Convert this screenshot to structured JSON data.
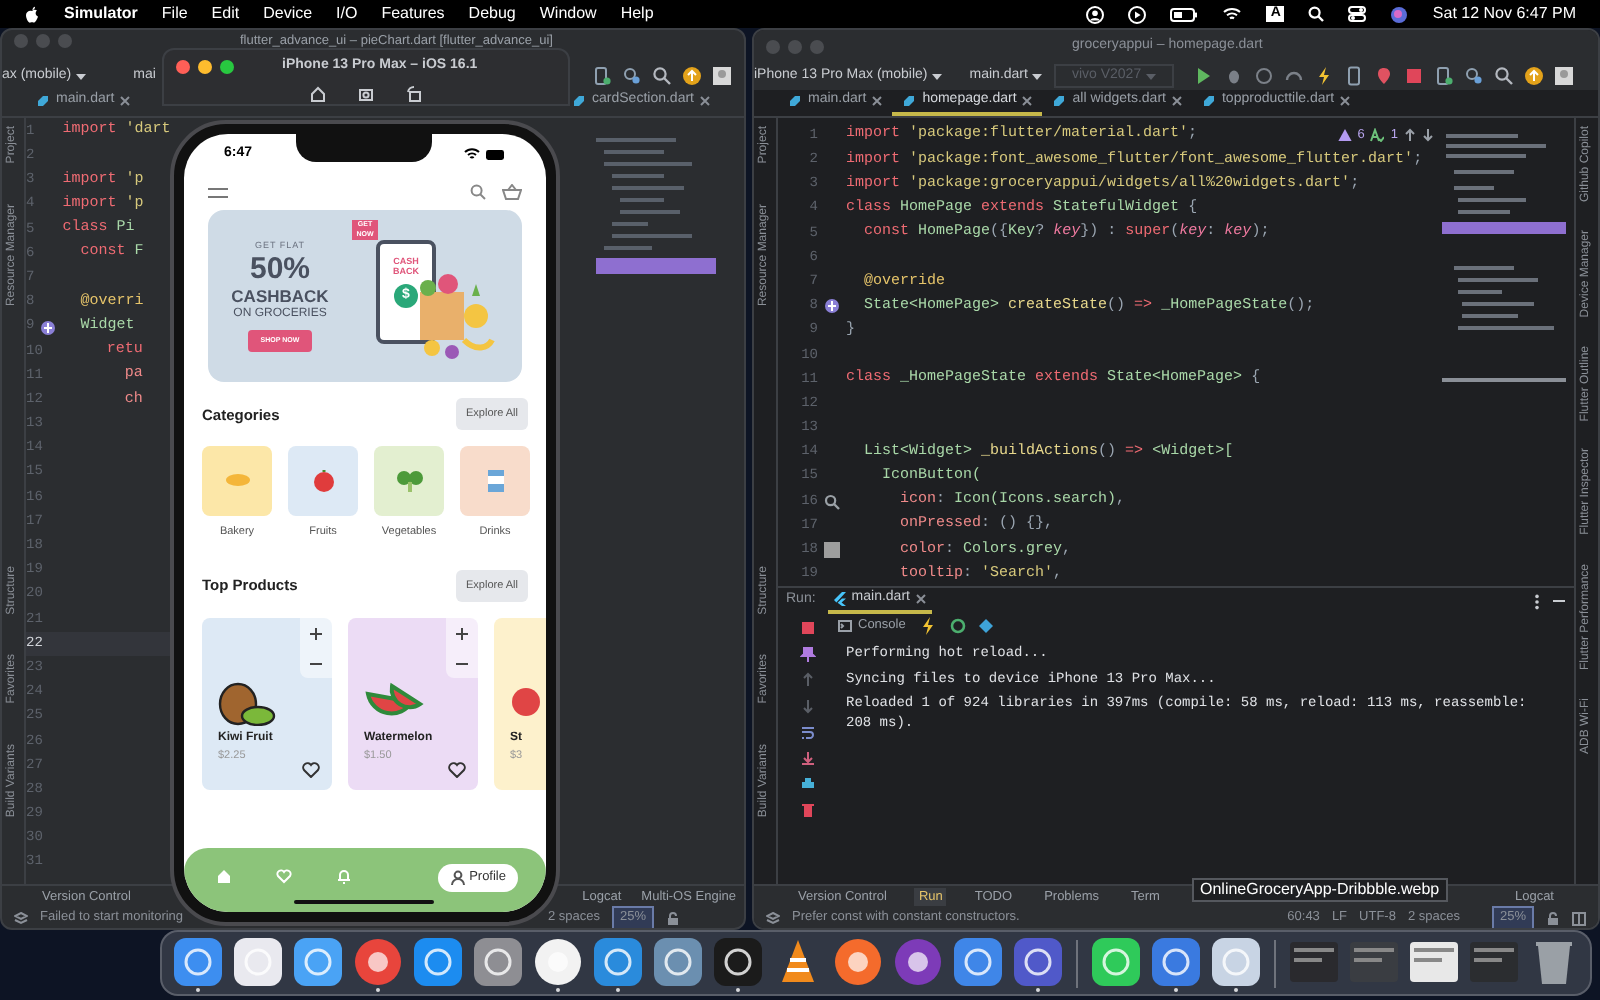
{
  "menu_bar": {
    "app": "Simulator",
    "items": [
      "File",
      "Edit",
      "Device",
      "I/O",
      "Features",
      "Debug",
      "Window",
      "Help"
    ],
    "input_source": "A",
    "clock": "Sat 12 Nov 6:47 PM"
  },
  "left_ide": {
    "title": "flutter_advance_ui – pieChart.dart [flutter_advance_ui]",
    "device": "ax (mobile)",
    "run_config": "mai",
    "tabs": [
      {
        "label": "main.dart",
        "selected": false
      },
      {
        "label": "cardSection.dart",
        "selected": false
      }
    ],
    "side_labels": [
      "Project",
      "Resource Manager",
      "Structure",
      "Favorites",
      "Build Variants"
    ],
    "lines": [
      {
        "number": "1",
        "tokens": [
          {
            "text": "import ",
            "kind": "kw"
          },
          {
            "text": "'dart",
            "kind": "str"
          }
        ]
      },
      {
        "number": "2"
      },
      {
        "number": "3",
        "tokens": [
          {
            "text": "import ",
            "kind": "kw"
          },
          {
            "text": "'p",
            "kind": "str"
          }
        ]
      },
      {
        "number": "4",
        "tokens": [
          {
            "text": "import ",
            "kind": "kw"
          },
          {
            "text": "'p",
            "kind": "str"
          }
        ]
      },
      {
        "number": "5",
        "tokens": [
          {
            "text": "class ",
            "kind": "kw"
          },
          {
            "text": "Pi",
            "kind": "type"
          }
        ]
      },
      {
        "number": "6",
        "tokens": [
          {
            "text": "  const ",
            "kind": "kw"
          },
          {
            "text": "F",
            "kind": "type"
          }
        ]
      },
      {
        "number": "7"
      },
      {
        "number": "8",
        "tokens": [
          {
            "text": "  @overri",
            "kind": "ann"
          }
        ]
      },
      {
        "number": "9",
        "tokens": [
          {
            "text": "  Widget",
            "kind": "type"
          }
        ],
        "marker": {
          "kind": "override"
        }
      },
      {
        "number": "10",
        "tokens": [
          {
            "text": "    retu",
            "kind": "kw"
          }
        ]
      },
      {
        "number": "11",
        "tokens": [
          {
            "text": "      pa",
            "kind": "prop"
          }
        ]
      },
      {
        "number": "12",
        "tokens": [
          {
            "text": "      ch",
            "kind": "prop"
          }
        ]
      },
      {
        "number": "13"
      },
      {
        "number": "14"
      },
      {
        "number": "15"
      },
      {
        "number": "16"
      },
      {
        "number": "17"
      },
      {
        "number": "18"
      },
      {
        "number": "19"
      },
      {
        "number": "20"
      },
      {
        "number": "21"
      },
      {
        "number": "22",
        "current": true
      },
      {
        "number": "23"
      },
      {
        "number": "24"
      },
      {
        "number": "25"
      },
      {
        "number": "26"
      },
      {
        "number": "27"
      },
      {
        "number": "28"
      },
      {
        "number": "29"
      },
      {
        "number": "30"
      },
      {
        "number": "31"
      }
    ],
    "bottom_tabs": [
      {
        "label": "Version Control",
        "selected": false
      },
      {
        "label": "Logcat",
        "selected": false
      },
      {
        "label": "Multi-OS Engine",
        "selected": false
      }
    ],
    "status": {
      "message": "Failed to start monitoring",
      "indent": "2 spaces",
      "memory": "25%"
    }
  },
  "simulator": {
    "title": "iPhone 13 Pro Max – iOS 16.1"
  },
  "phone": {
    "time": "6:47",
    "banner": {
      "pre": "GET FLAT",
      "amount": "50%",
      "headline": "CASHBACK",
      "sub": "ON GROCERIES",
      "button": "SHOP NOW",
      "tag": "GET NOW",
      "screen_text": "CASH BACK",
      "coin": "$"
    },
    "categories": {
      "title": "Categories",
      "action": "Explore All",
      "items": [
        {
          "label": "Bakery",
          "color": "#fce7a8"
        },
        {
          "label": "Fruits",
          "color": "#dde9f5"
        },
        {
          "label": "Vegetables",
          "color": "#e3efd0"
        },
        {
          "label": "Drinks",
          "color": "#f8dccb"
        }
      ]
    },
    "products": {
      "title": "Top Products",
      "action": "Explore All",
      "items": [
        {
          "name": "Kiwi Fruit",
          "price": "$2.25",
          "color": "#dde9f5"
        },
        {
          "name": "Watermelon",
          "price": "$1.50",
          "color": "#ecdcf5"
        },
        {
          "name": "St",
          "price": "$3",
          "color": "#fdf1cc"
        }
      ]
    },
    "nav": [
      {
        "kind": "home",
        "selected": false
      },
      {
        "kind": "heart",
        "selected": false
      },
      {
        "kind": "bell",
        "selected": false
      },
      {
        "kind": "profile",
        "label": "Profile",
        "selected": true
      }
    ]
  },
  "right_ide": {
    "title": "groceryappui – homepage.dart",
    "device": "iPhone 13 Pro Max (mobile)",
    "run_config": "main.dart",
    "other_device": {
      "label": "vivo V2027",
      "disabled": true
    },
    "tabs": [
      {
        "label": "main.dart",
        "selected": false
      },
      {
        "label": "homepage.dart",
        "selected": true
      },
      {
        "label": "all widgets.dart",
        "selected": false
      },
      {
        "label": "topproducttile.dart",
        "selected": false
      }
    ],
    "inspection": {
      "warnings": "6",
      "typos": "1"
    },
    "side_labels": [
      "Project",
      "Resource Manager",
      "Structure",
      "Favorites",
      "Build Variants"
    ],
    "right_labels": [
      "Github Copilot",
      "Device Manager",
      "Flutter Outline",
      "Flutter Inspector",
      "Flutter Performance",
      "ADB Wi-Fi"
    ],
    "lines": [
      {
        "number": "1",
        "tokens": [
          {
            "text": "import ",
            "kind": "kw"
          },
          {
            "text": "'package:flutter/material.dart'",
            "kind": "str"
          },
          {
            "text": ";",
            "kind": "punct"
          }
        ]
      },
      {
        "number": "2",
        "tokens": [
          {
            "text": "import ",
            "kind": "kw"
          },
          {
            "text": "'package:font_awesome_flutter/font_awesome_flutter.dart'",
            "kind": "str"
          },
          {
            "text": ";",
            "kind": "punct"
          }
        ]
      },
      {
        "number": "3",
        "tokens": [
          {
            "text": "import ",
            "kind": "kw"
          },
          {
            "text": "'package:groceryappui/widgets/all%20widgets.dart'",
            "kind": "str"
          },
          {
            "text": ";",
            "kind": "punct"
          }
        ]
      },
      {
        "number": "4",
        "tokens": [
          {
            "text": "class ",
            "kind": "kw"
          },
          {
            "text": "HomePage ",
            "kind": "type"
          },
          {
            "text": "extends ",
            "kind": "kw"
          },
          {
            "text": "StatefulWidget ",
            "kind": "type"
          },
          {
            "text": "{",
            "kind": "punct"
          }
        ]
      },
      {
        "number": "5",
        "tokens": [
          {
            "text": "  const ",
            "kind": "kw"
          },
          {
            "text": "HomePage",
            "kind": "type"
          },
          {
            "text": "({",
            "kind": "punct"
          },
          {
            "text": "Key",
            "kind": "type"
          },
          {
            "text": "? ",
            "kind": "punct"
          },
          {
            "text": "key",
            "kind": "param"
          },
          {
            "text": "}) : ",
            "kind": "punct"
          },
          {
            "text": "super",
            "kind": "kw"
          },
          {
            "text": "(",
            "kind": "punct"
          },
          {
            "text": "key",
            "kind": "param"
          },
          {
            "text": ": ",
            "kind": "punct"
          },
          {
            "text": "key",
            "kind": "param"
          },
          {
            "text": ");",
            "kind": "punct"
          }
        ]
      },
      {
        "number": "6"
      },
      {
        "number": "7",
        "tokens": [
          {
            "text": "  @override",
            "kind": "ann"
          }
        ]
      },
      {
        "number": "8",
        "tokens": [
          {
            "text": "  State<HomePage> ",
            "kind": "type"
          },
          {
            "text": "createState",
            "kind": "fn"
          },
          {
            "text": "() ",
            "kind": "punct"
          },
          {
            "text": "=> ",
            "kind": "kw"
          },
          {
            "text": "_HomePageState",
            "kind": "type"
          },
          {
            "text": "();",
            "kind": "punct"
          }
        ],
        "marker": {
          "kind": "override"
        }
      },
      {
        "number": "9",
        "tokens": [
          {
            "text": "}",
            "kind": "punct"
          }
        ]
      },
      {
        "number": "10"
      },
      {
        "number": "11",
        "tokens": [
          {
            "text": "class ",
            "kind": "kw"
          },
          {
            "text": "_HomePageState ",
            "kind": "type"
          },
          {
            "text": "extends ",
            "kind": "kw"
          },
          {
            "text": "State<HomePage> ",
            "kind": "type"
          },
          {
            "text": "{",
            "kind": "punct"
          }
        ]
      },
      {
        "number": "12"
      },
      {
        "number": "13"
      },
      {
        "number": "14",
        "tokens": [
          {
            "text": "  List<Widget> ",
            "kind": "type"
          },
          {
            "text": "_buildActions",
            "kind": "fn"
          },
          {
            "text": "() ",
            "kind": "punct"
          },
          {
            "text": "=> ",
            "kind": "kw"
          },
          {
            "text": "<Widget>[",
            "kind": "type"
          }
        ]
      },
      {
        "number": "15",
        "tokens": [
          {
            "text": "    IconButton(",
            "kind": "type"
          }
        ]
      },
      {
        "number": "16",
        "tokens": [
          {
            "text": "      icon",
            "kind": "prop"
          },
          {
            "text": ": ",
            "kind": "punct"
          },
          {
            "text": "Icon(Icons.search)",
            "kind": "type"
          },
          {
            "text": ",",
            "kind": "punct"
          }
        ],
        "marker": {
          "kind": "search"
        }
      },
      {
        "number": "17",
        "tokens": [
          {
            "text": "      onPressed",
            "kind": "prop"
          },
          {
            "text": ": () {},",
            "kind": "punct"
          }
        ]
      },
      {
        "number": "18",
        "tokens": [
          {
            "text": "      color",
            "kind": "prop"
          },
          {
            "text": ": ",
            "kind": "punct"
          },
          {
            "text": "Colors.grey",
            "kind": "type"
          },
          {
            "text": ",",
            "kind": "punct"
          }
        ],
        "marker": {
          "kind": "swatch"
        }
      },
      {
        "number": "19",
        "tokens": [
          {
            "text": "      tooltip",
            "kind": "prop"
          },
          {
            "text": ": ",
            "kind": "punct"
          },
          {
            "text": "'Search'",
            "kind": "str"
          },
          {
            "text": ",",
            "kind": "punct"
          }
        ]
      }
    ],
    "run": {
      "label": "Run:",
      "tab": "main.dart",
      "console": "Console",
      "output": [
        "Performing hot reload...",
        "Syncing files to device iPhone 13 Pro Max...",
        "Reloaded 1 of 924 libraries in 397ms (compile: 58 ms, reload: 113 ms, reassemble: 208 ms)."
      ]
    },
    "bottom_tabs": [
      {
        "label": "Version Control",
        "selected": false
      },
      {
        "label": "Run",
        "selected": true
      },
      {
        "label": "TODO",
        "selected": false
      },
      {
        "label": "Problems",
        "selected": false
      },
      {
        "label": "Term",
        "selected": false
      },
      {
        "label": "Logcat",
        "selected": false
      }
    ],
    "status": {
      "message": "Prefer const with constant constructors.",
      "position": "60:43",
      "line_sep": "LF",
      "encoding": "UTF-8",
      "indent": "2 spaces",
      "memory": "25%"
    }
  },
  "tooltip": "OnlineGroceryApp-Dribbble.webp",
  "dock": [
    {
      "kind": "app",
      "color": "#3d8ef0",
      "running": true
    },
    {
      "kind": "app",
      "color": "#e9e9ef",
      "running": false
    },
    {
      "kind": "app",
      "color": "#4aa3f5",
      "running": false
    },
    {
      "kind": "round",
      "color": "#e8453c",
      "running": true
    },
    {
      "kind": "app",
      "color": "#1c8cf0",
      "running": false
    },
    {
      "kind": "app",
      "color": "#8e8e93",
      "running": false
    },
    {
      "kind": "round",
      "color": "#f2f2f2",
      "running": true
    },
    {
      "kind": "app",
      "color": "#2a8bdc",
      "running": true
    },
    {
      "kind": "app",
      "color": "#6b8fb0",
      "running": false
    },
    {
      "kind": "app",
      "color": "#1b1b1b",
      "running": true
    },
    {
      "kind": "cone",
      "color": "#f18a1c",
      "running": false
    },
    {
      "kind": "round",
      "color": "#f46b2c",
      "running": false
    },
    {
      "kind": "round",
      "color": "#7d3bb8",
      "running": false
    },
    {
      "kind": "app",
      "color": "#3f86e8",
      "running": false
    },
    {
      "kind": "app",
      "color": "#5059c9",
      "running": true
    },
    {
      "kind": "separator"
    },
    {
      "kind": "app",
      "color": "#2fca5a",
      "running": false
    },
    {
      "kind": "app",
      "color": "#3a7ae0",
      "running": true
    },
    {
      "kind": "app",
      "color": "#c8d4e4",
      "running": true
    },
    {
      "kind": "separator"
    },
    {
      "kind": "window",
      "color": "#2a2a2e",
      "running": false
    },
    {
      "kind": "window",
      "color": "#3a3d42",
      "running": false
    },
    {
      "kind": "window",
      "color": "#e8e8e8",
      "running": false
    },
    {
      "kind": "window",
      "color": "#2b2d30",
      "running": false
    },
    {
      "kind": "trash",
      "color": "#9aa0a6",
      "running": false
    }
  ]
}
